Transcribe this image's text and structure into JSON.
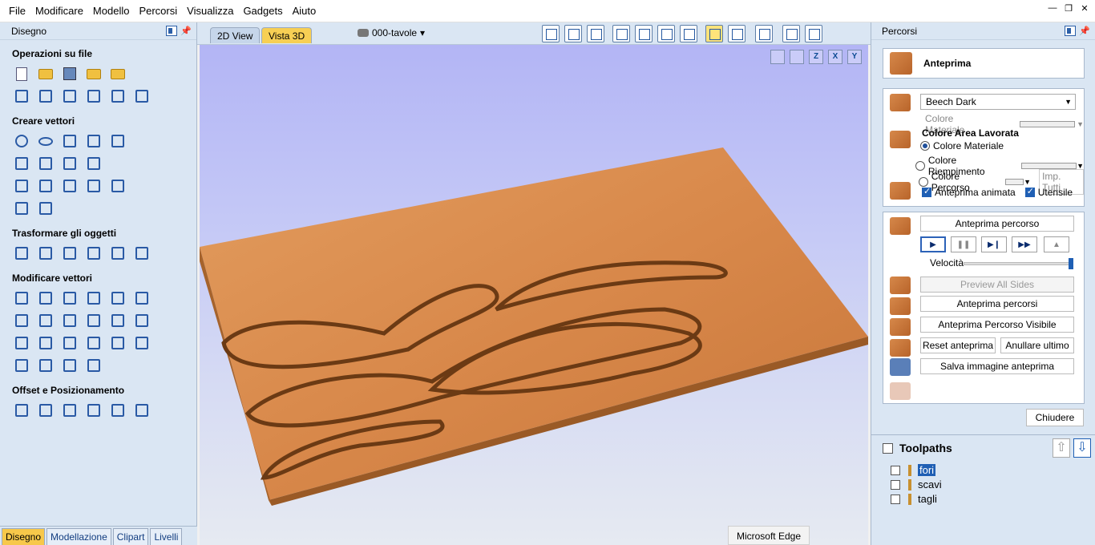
{
  "menu": [
    "File",
    "Modificare",
    "Modello",
    "Percorsi",
    "Visualizza",
    "Gadgets",
    "Aiuto"
  ],
  "left_panel": {
    "title": "Disegno",
    "sections": [
      {
        "title": "Operazioni su file",
        "rows": [
          [
            "new-file-icon",
            "open-folder-icon",
            "save-icon",
            "open-folder-icon",
            "import-icon"
          ],
          [
            "select-all-icon",
            "cut-icon",
            "copy-icon",
            "paste-icon",
            "undo-icon",
            "redo-icon"
          ]
        ]
      },
      {
        "title": "Creare vettori",
        "rows": [
          [
            "circle-icon",
            "ellipse-icon",
            "rectangle-icon",
            "polygon-icon",
            "star-icon"
          ],
          [
            "polyline-icon",
            "arc-icon",
            "curve-icon",
            "spiral-icon"
          ],
          [
            "text-icon",
            "text-box-icon",
            "text-on-curve-icon",
            "text-resize-icon",
            "text-arc-icon"
          ],
          [
            "bird-icon",
            "dimension-icon"
          ]
        ]
      },
      {
        "title": "Trasformare gli oggetti",
        "rows": [
          [
            "move-icon",
            "scale-icon",
            "align-icon",
            "mirror-icon",
            "distort-icon",
            "center-icon"
          ]
        ]
      },
      {
        "title": "Modificare vettori",
        "rows": [
          [
            "select-arrow-icon",
            "node-edit-icon",
            "node-add-icon",
            "group-icon",
            "ungroup-icon",
            "measure-icon"
          ],
          [
            "weld-icon",
            "subtract-icon",
            "intersect-icon",
            "trim-icon",
            "scissors-icon",
            "fillet-icon"
          ],
          [
            "chamfer-icon",
            "curve-fit-icon",
            "smooth-icon",
            "close-vector-icon",
            "offset-vector-icon",
            "fit-icon"
          ],
          [
            "join-icon",
            "extend-icon",
            "bend-icon",
            "break-icon"
          ]
        ]
      },
      {
        "title": "Offset e Posizionamento",
        "rows": [
          [
            "offset-icon",
            "array-icon",
            "nesting-icon",
            "copy-along-icon",
            "grid-array-icon",
            "layout-icon"
          ]
        ]
      }
    ],
    "bottom_tabs": [
      "Disegno",
      "Modellazione",
      "Clipart",
      "Livelli"
    ]
  },
  "view": {
    "tabs": [
      "2D View",
      "Vista 3D"
    ],
    "active_tab": "Vista 3D",
    "layer": "000-tavole",
    "axis_buttons": [
      "fit-icon",
      "axis-iso-icon",
      "axis-z-icon",
      "axis-x-icon",
      "axis-y-icon"
    ],
    "axis_labels": [
      "",
      "",
      "Z",
      "X",
      "Y"
    ]
  },
  "taskbar_tooltip": "Microsoft Edge",
  "right_panel": {
    "title": "Percorsi",
    "preview_title": "Anteprima",
    "material": "Beech Dark",
    "colore_materiale_label": "Colore Materiale",
    "area_title": "Colore Area Lavorata",
    "radio_colore_materiale": "Colore Materiale",
    "radio_colore_riempimento": "Colore Riempimento",
    "radio_colore_percorso": "Colore Percorso",
    "imp_tutti": "Imp. Tutti",
    "chk_anteprima_animata": "Anteprima animata",
    "chk_utensile": "Utensile",
    "btn_anteprima_percorso": "Anteprima percorso",
    "velocita": "Velocità",
    "btn_preview_all_sides": "Preview All Sides",
    "btn_anteprima_percorsi": "Anteprima percorsi",
    "btn_anteprima_visibile": "Anteprima Percorso Visibile",
    "btn_reset": "Reset anteprima",
    "btn_annullare": "Anullare ultimo",
    "btn_salva": "Salva immagine anteprima",
    "btn_chiudere": "Chiudere"
  },
  "toolpaths": {
    "title": "Toolpaths",
    "items": [
      {
        "name": "fori",
        "selected": true
      },
      {
        "name": "scavi",
        "selected": false
      },
      {
        "name": "tagli",
        "selected": false
      }
    ]
  },
  "colors": {
    "wood": "#d8884a",
    "accent_yellow": "#f7c84a",
    "panel_bg": "#dae6f3",
    "select_blue": "#1f5fb4"
  }
}
